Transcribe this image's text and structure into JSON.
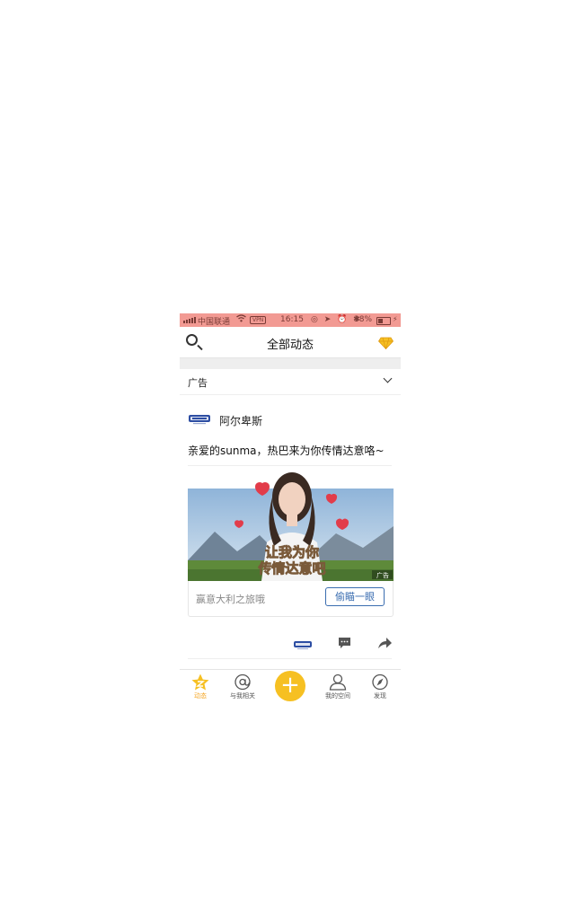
{
  "status_bar": {
    "carrier": "中国联通",
    "vpn": "VPN",
    "time": "16:15",
    "battery": "38%",
    "background": "#f29a93"
  },
  "nav": {
    "title": "全部动态",
    "left_icon": "search-icon",
    "right_icon": "diamond-vip-icon"
  },
  "ad_bar": {
    "label": "广告",
    "icon": "chevron-down-icon"
  },
  "post": {
    "author": "阿尔卑斯",
    "text": "亲爱的sunma，热巴来为你传情达意咯~",
    "image_caption_line1": "让我为你",
    "image_caption_line2": "传情达意吧",
    "image_badge": "广告",
    "footer_text": "赢意大利之旅哦",
    "cta_button": "偷瞄一眼"
  },
  "tabs": [
    {
      "label": "动态",
      "icon": "star-home-icon",
      "active": true
    },
    {
      "label": "与我相关",
      "icon": "at-icon",
      "active": false
    },
    {
      "label": "",
      "icon": "plus-icon",
      "active": false
    },
    {
      "label": "我的空间",
      "icon": "person-icon",
      "active": false
    },
    {
      "label": "发现",
      "icon": "compass-icon",
      "active": false
    }
  ],
  "colors": {
    "accent": "#f6c022",
    "link": "#3a6db0"
  }
}
